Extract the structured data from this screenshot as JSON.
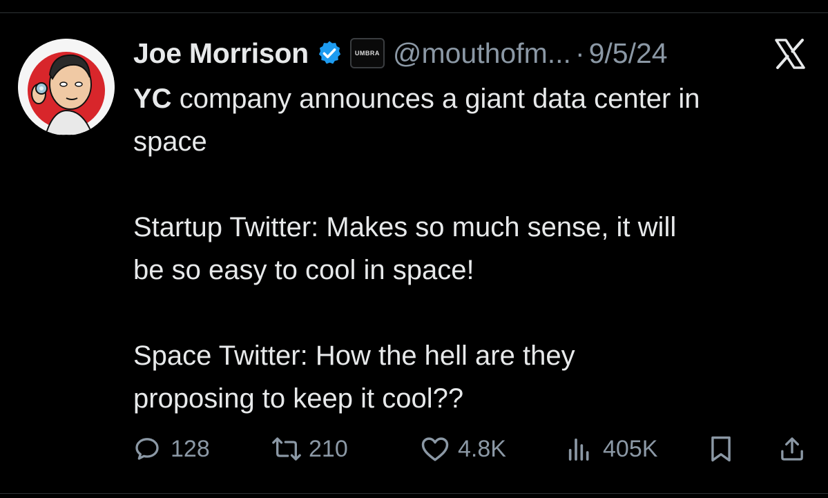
{
  "author": {
    "name": "Joe Morrison",
    "org_badge": "UMBRA",
    "handle": "@mouthofm...",
    "separator": "·",
    "date": "9/5/24"
  },
  "tweet": {
    "bold_prefix": "YC",
    "line1_rest": " company announces a giant data center in",
    "line2": "space",
    "line3": "Startup Twitter: Makes so much sense, it will",
    "line4": "be so easy to cool in space!",
    "line5": "Space Twitter: How the hell are they",
    "line6": "proposing to keep it cool??"
  },
  "actions": {
    "replies": "128",
    "retweets": "210",
    "likes": "4.8K",
    "views": "405K"
  },
  "colors": {
    "background": "#000000",
    "text": "#e7e9ea",
    "muted": "#8b98a5",
    "verified": "#1d9bf0",
    "avatar_accent": "#d8262b"
  },
  "icons": [
    "verified-badge-icon",
    "x-logo-icon",
    "reply-icon",
    "retweet-icon",
    "like-icon",
    "views-icon",
    "bookmark-icon",
    "share-icon"
  ]
}
